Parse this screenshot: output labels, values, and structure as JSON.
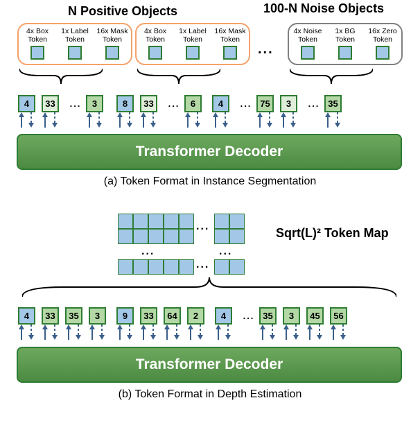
{
  "header": {
    "positive": "N Positive Objects",
    "noise": "100-N Noise Objects"
  },
  "groups": {
    "pos": [
      {
        "l1": "4x Box",
        "l2": "Token"
      },
      {
        "l1": "1x Label",
        "l2": "Token"
      },
      {
        "l1": "16x Mask",
        "l2": "Token"
      }
    ],
    "noise": [
      {
        "l1": "4x Noise",
        "l2": "Token"
      },
      {
        "l1": "1x BG",
        "l2": "Token"
      },
      {
        "l1": "16x Zero",
        "l2": "Token"
      }
    ]
  },
  "instance_tokens": [
    {
      "v": "4",
      "c": "blue"
    },
    {
      "v": "33",
      "c": "ltgreen"
    },
    {
      "dots": true
    },
    {
      "v": "3",
      "c": "green"
    },
    {
      "gap": 10
    },
    {
      "v": "8",
      "c": "blue"
    },
    {
      "v": "33",
      "c": "ltgreen"
    },
    {
      "dots": true
    },
    {
      "v": "6",
      "c": "green"
    },
    {
      "gap": 6
    },
    {
      "v": "4",
      "c": "blue"
    },
    {
      "dots": true
    },
    {
      "v": "75",
      "c": "green"
    },
    {
      "v": "3",
      "c": "ltgreen"
    },
    {
      "dots": true
    },
    {
      "v": "35",
      "c": "green"
    }
  ],
  "depth_tokens": [
    {
      "v": "4",
      "c": "blue"
    },
    {
      "v": "33",
      "c": "green"
    },
    {
      "v": "35",
      "c": "green"
    },
    {
      "v": "3",
      "c": "green"
    },
    {
      "gap": 6
    },
    {
      "v": "9",
      "c": "blue"
    },
    {
      "v": "33",
      "c": "green"
    },
    {
      "v": "64",
      "c": "green"
    },
    {
      "v": "2",
      "c": "green"
    },
    {
      "gap": 6
    },
    {
      "v": "4",
      "c": "blue"
    },
    {
      "dots": true
    },
    {
      "v": "35",
      "c": "green"
    },
    {
      "v": "3",
      "c": "green"
    },
    {
      "v": "45",
      "c": "green"
    },
    {
      "v": "56",
      "c": "green"
    }
  ],
  "decoder_label": "Transformer Decoder",
  "caption_a": "(a) Token Format in Instance Segmentation",
  "caption_b": "(b) Token Format in Depth Estimation",
  "tokenmap_label": "Sqrt(L)² Token Map",
  "colors": {
    "orange_border": "#f4a26a",
    "grey_border": "#808080",
    "token_blue": "#a3c7e6",
    "token_green": "#b3d8a5",
    "token_ltgreen": "#dfeed8",
    "decoder_border": "#2e7d32",
    "arrow": "#3a5f8a"
  }
}
